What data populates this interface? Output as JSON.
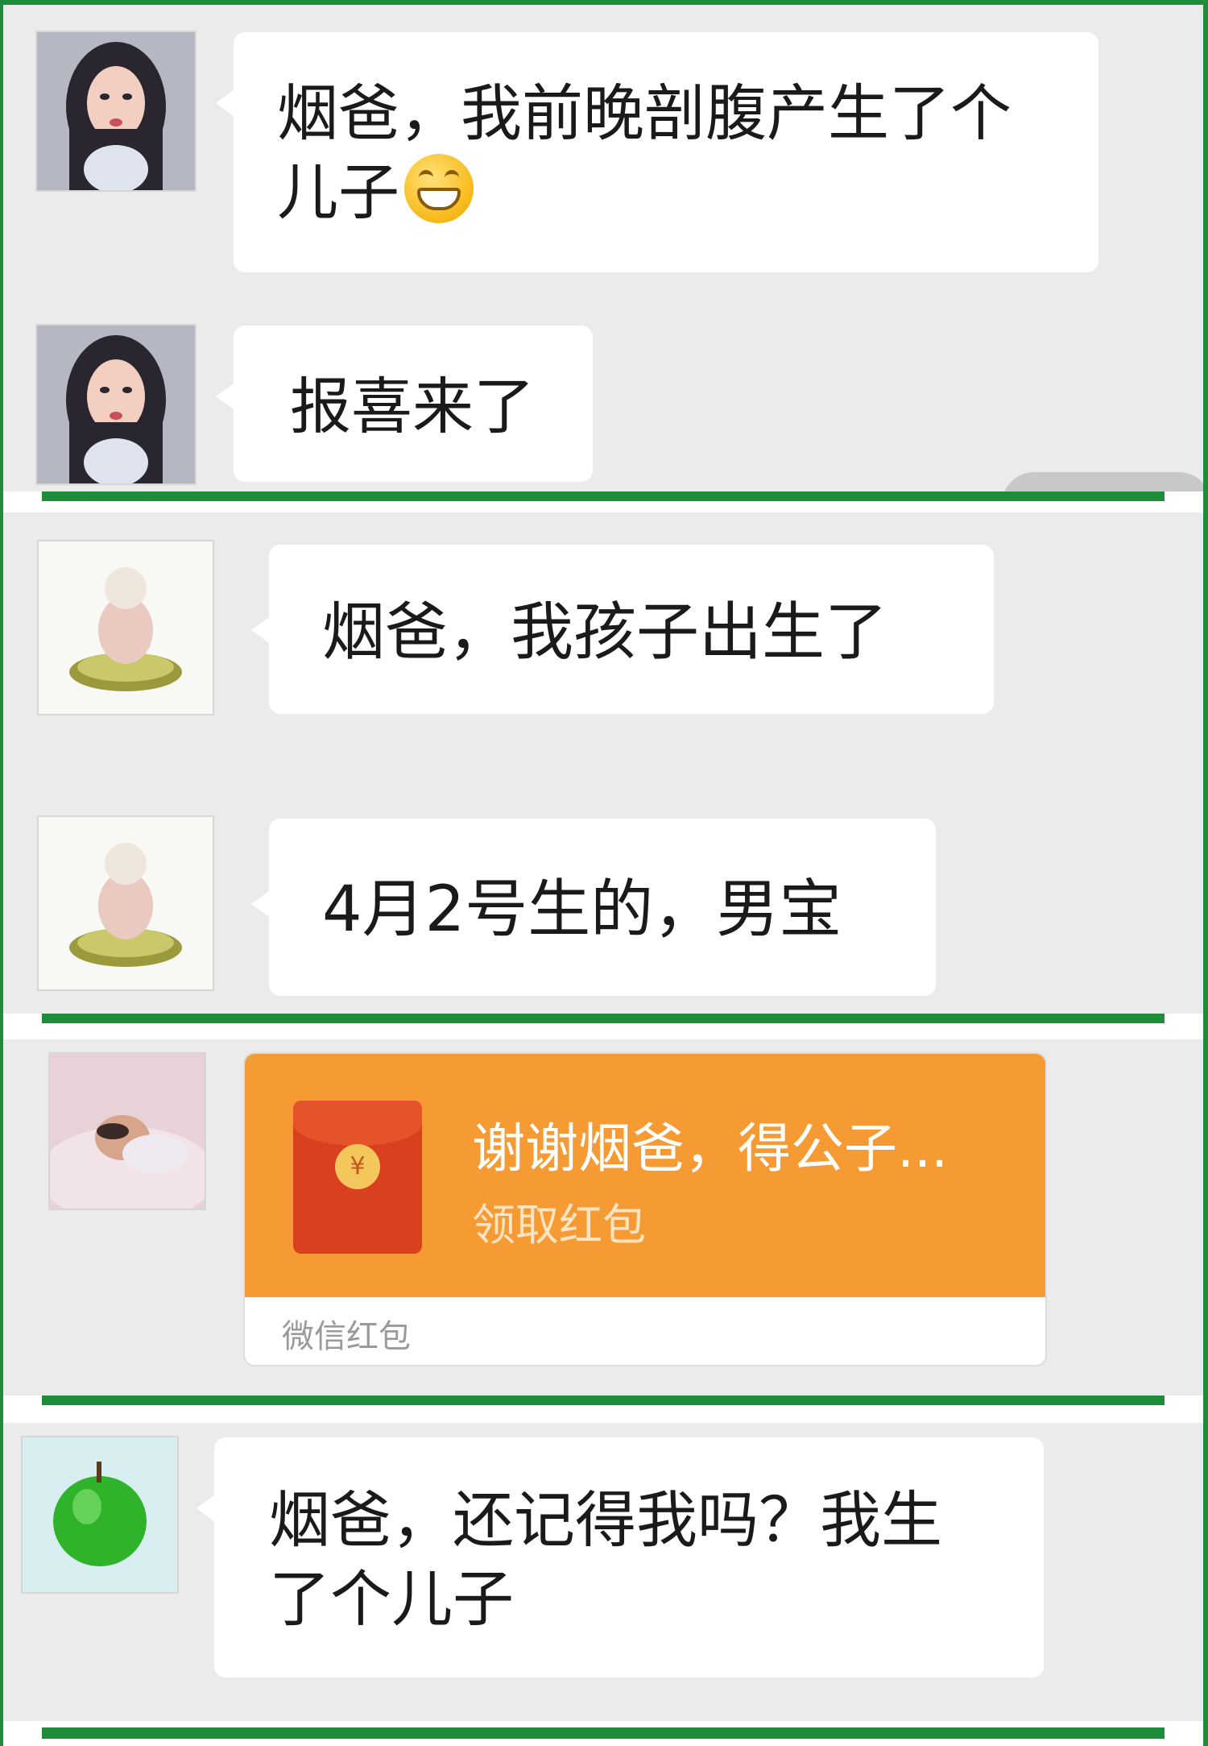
{
  "messages": [
    {
      "id": "m1",
      "text": "烟爸，我前晚剖腹产生了个儿子",
      "line1": "烟爸，我前晚剖腹产生了个",
      "line2": "儿子",
      "emoji": "grinning-emoji"
    },
    {
      "id": "m2",
      "text": "报喜来了"
    },
    {
      "id": "m3",
      "text": "烟爸，我孩子出生了"
    },
    {
      "id": "m4",
      "text": "4月2号生的，男宝"
    },
    {
      "id": "m5",
      "type": "red-packet",
      "title": "谢谢烟爸，得公子...",
      "action": "领取红包",
      "footer": "微信红包",
      "coin_symbol": "¥"
    },
    {
      "id": "m6",
      "line1": "烟爸，还记得我吗？我生",
      "line2": "了个儿子"
    }
  ],
  "colors": {
    "divider": "#1e8c3a",
    "background": "#ebebeb",
    "bubble": "#ffffff",
    "red_packet": "#f69b34",
    "envelope": "#d9401f"
  },
  "icons": [
    "grinning-emoji",
    "avatar-woman",
    "avatar-figurine",
    "avatar-baby",
    "avatar-green-apple",
    "red-envelope-icon"
  ]
}
